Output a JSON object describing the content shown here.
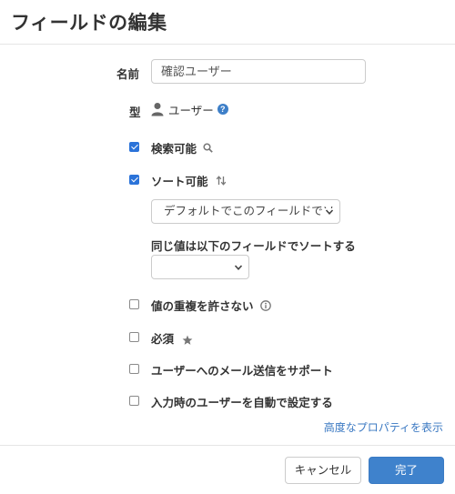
{
  "dialog": {
    "title": "フィールドの編集"
  },
  "fields": {
    "name_label": "名前",
    "name_value": "確認ユーザー",
    "type_label": "型",
    "type_value": "ユーザー",
    "type_help_glyph": "?"
  },
  "options": {
    "searchable": {
      "label": "検索可能",
      "checked": true,
      "icon": "search-icon"
    },
    "sortable": {
      "label": "ソート可能",
      "checked": true,
      "icon": "sort-arrows-icon"
    },
    "sort_select_value": "デフォルトでこのフィールドでソ",
    "same_value_label": "同じ値は以下のフィールドでソートする",
    "same_value_select_value": "",
    "no_duplicates": {
      "label": "値の重複を許さない",
      "checked": false,
      "icon": "info-icon"
    },
    "required": {
      "label": "必須",
      "checked": false,
      "icon": "star-icon"
    },
    "email_support": {
      "label": "ユーザーへのメール送信をサポート",
      "checked": false
    },
    "auto_set": {
      "label": "入力時のユーザーを自動で設定する",
      "checked": false
    }
  },
  "advanced_link": "高度なプロパティを表示",
  "footer": {
    "cancel_label": "キャンセル",
    "ok_label": "完了"
  },
  "colors": {
    "accent": "#3f82cc",
    "checkbox_checked": "#2b73d9",
    "link": "#3a78c2",
    "help_icon": "#3d7fc8"
  }
}
